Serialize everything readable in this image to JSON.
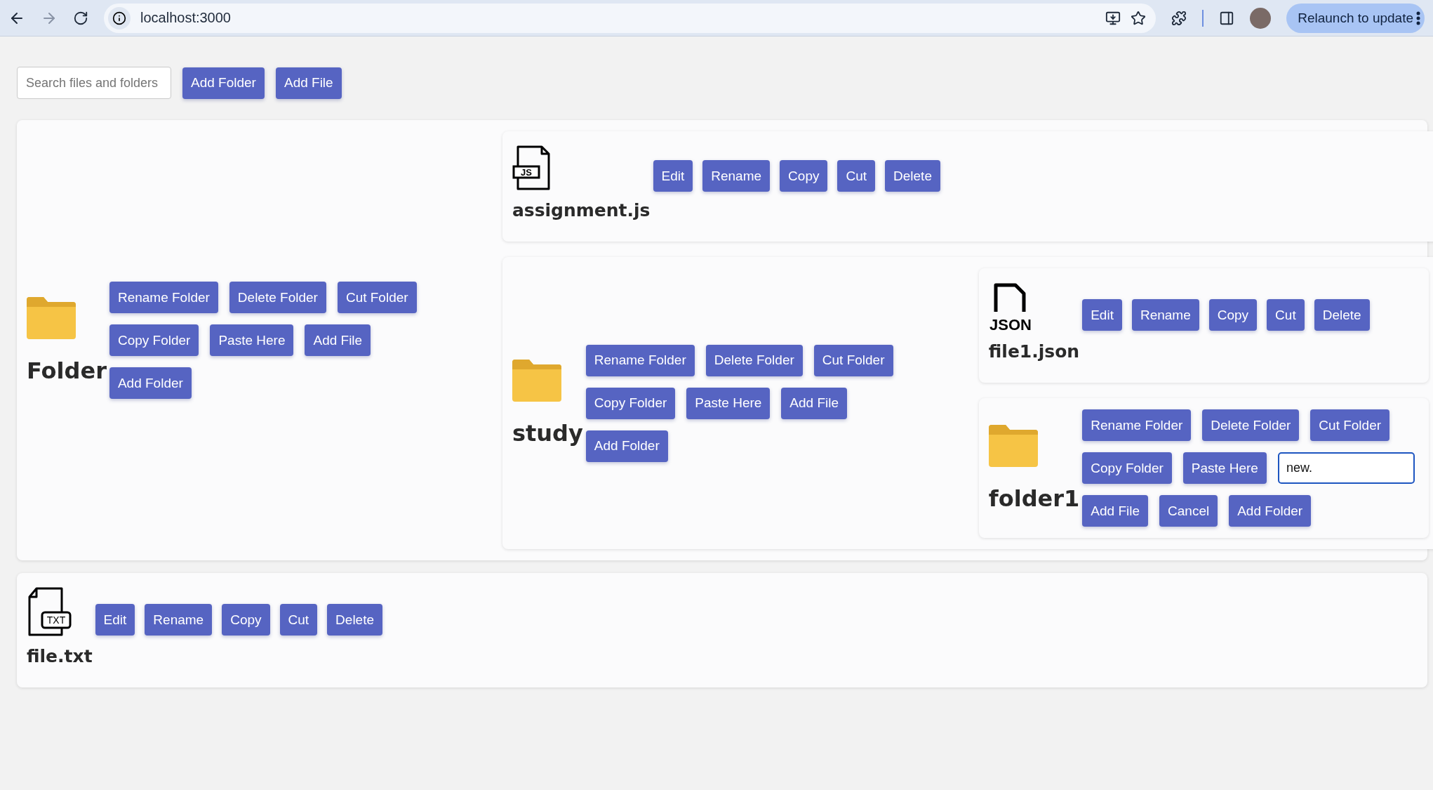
{
  "browser": {
    "url": "localhost:3000",
    "relaunch": "Relaunch to update"
  },
  "toolbar": {
    "search": {
      "placeholder": "Search files and folders"
    },
    "buttons": [
      "Add Folder",
      "Add File"
    ]
  },
  "tree": [
    {
      "kind": "folder",
      "name": "Folder",
      "actions": [
        {
          "kind": "button",
          "label": "Rename Folder"
        },
        {
          "kind": "button",
          "label": "Delete Folder"
        },
        {
          "kind": "button",
          "label": "Cut Folder"
        },
        {
          "kind": "button",
          "label": "Copy Folder"
        },
        {
          "kind": "button",
          "label": "Paste Here"
        },
        {
          "kind": "button",
          "label": "Add File"
        },
        {
          "kind": "button",
          "label": "Add Folder"
        }
      ],
      "children": [
        {
          "kind": "js",
          "badge": "JS",
          "name": "assignment.js",
          "actions": [
            {
              "kind": "button",
              "label": "Edit"
            },
            {
              "kind": "button",
              "label": "Rename"
            },
            {
              "kind": "button",
              "label": "Copy"
            },
            {
              "kind": "button",
              "label": "Cut"
            },
            {
              "kind": "button",
              "label": "Delete"
            }
          ]
        },
        {
          "kind": "folder",
          "name": "study",
          "actions": [
            {
              "kind": "button",
              "label": "Rename Folder"
            },
            {
              "kind": "button",
              "label": "Delete Folder"
            },
            {
              "kind": "button",
              "label": "Cut Folder"
            },
            {
              "kind": "button",
              "label": "Copy Folder"
            },
            {
              "kind": "button",
              "label": "Paste Here"
            },
            {
              "kind": "button",
              "label": "Add File"
            },
            {
              "kind": "button",
              "label": "Add Folder"
            }
          ],
          "children": [
            {
              "kind": "json",
              "badge": "JSON",
              "name": "file1.json",
              "actions": [
                {
                  "kind": "button",
                  "label": "Edit"
                },
                {
                  "kind": "button",
                  "label": "Rename"
                },
                {
                  "kind": "button",
                  "label": "Copy"
                },
                {
                  "kind": "button",
                  "label": "Cut"
                },
                {
                  "kind": "button",
                  "label": "Delete"
                }
              ]
            },
            {
              "kind": "folder",
              "name": "folder1",
              "actions": [
                {
                  "kind": "button",
                  "label": "Rename Folder"
                },
                {
                  "kind": "button",
                  "label": "Delete Folder"
                },
                {
                  "kind": "button",
                  "label": "Cut Folder"
                },
                {
                  "kind": "button",
                  "label": "Copy Folder"
                },
                {
                  "kind": "button",
                  "label": "Paste Here"
                },
                {
                  "kind": "input",
                  "value": "new."
                },
                {
                  "kind": "button",
                  "label": "Add File"
                },
                {
                  "kind": "button",
                  "label": "Cancel"
                },
                {
                  "kind": "button",
                  "label": "Add Folder"
                }
              ]
            }
          ]
        }
      ]
    },
    {
      "kind": "txt",
      "badge": "TXT",
      "name": "file.txt",
      "actions": [
        {
          "kind": "button",
          "label": "Edit"
        },
        {
          "kind": "button",
          "label": "Rename"
        },
        {
          "kind": "button",
          "label": "Copy"
        },
        {
          "kind": "button",
          "label": "Cut"
        },
        {
          "kind": "button",
          "label": "Delete"
        }
      ]
    }
  ]
}
